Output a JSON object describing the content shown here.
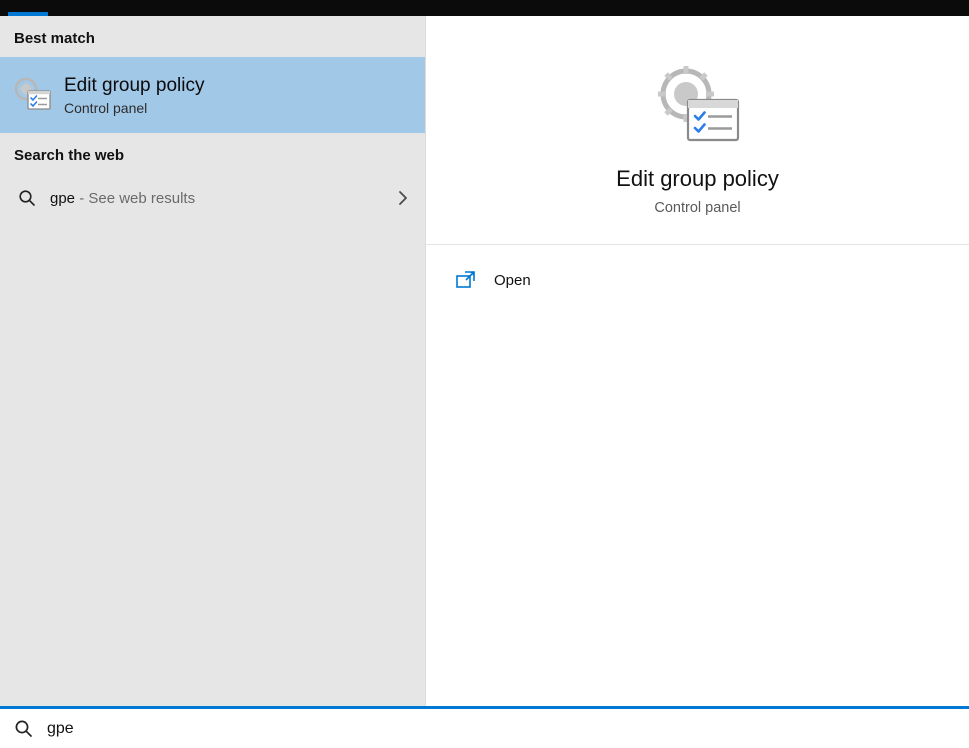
{
  "left": {
    "best_match_header": "Best match",
    "best_match": {
      "title": "Edit group policy",
      "subtitle": "Control panel"
    },
    "search_web_header": "Search the web",
    "web_item": {
      "query": "gpe",
      "suffix": " - See web results"
    }
  },
  "preview": {
    "title": "Edit group policy",
    "subtitle": "Control panel",
    "actions": {
      "open": "Open"
    }
  },
  "search": {
    "value": "gpe"
  }
}
